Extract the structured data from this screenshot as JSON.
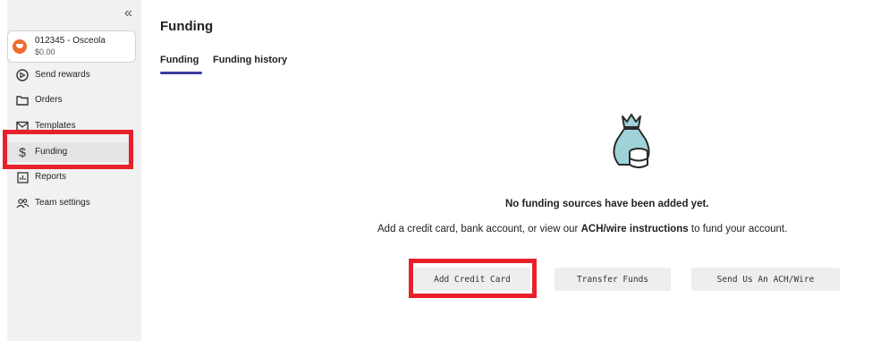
{
  "sidebar": {
    "collapse_glyph": "«",
    "account": {
      "name": "012345 - Osceola",
      "balance": "$0.00",
      "avatar_color": "#ec6b2d"
    },
    "items": [
      {
        "label": "Send rewards",
        "icon": "send-icon"
      },
      {
        "label": "Orders",
        "icon": "folder-icon"
      },
      {
        "label": "Templates",
        "icon": "mail-icon"
      },
      {
        "label": "Funding",
        "icon": "dollar-icon",
        "active": true
      },
      {
        "label": "Reports",
        "icon": "chart-icon"
      },
      {
        "label": "Team settings",
        "icon": "team-icon"
      }
    ]
  },
  "main": {
    "title": "Funding",
    "tabs": [
      {
        "label": "Funding",
        "active": true
      },
      {
        "label": "Funding history"
      }
    ],
    "empty_state": {
      "icon": "money-bag-icon",
      "title": "No funding sources have been added yet.",
      "desc_pre": "Add a credit card, bank account, or view our ",
      "desc_bold": "ACH/wire instructions",
      "desc_post": " to fund your account."
    },
    "buttons": {
      "add_credit_card": "Add Credit Card",
      "transfer_funds": "Transfer Funds",
      "send_ach": "Send Us An ACH/Wire"
    }
  },
  "colors": {
    "highlight": "#e8202a",
    "tab_underline": "#3b3c9e",
    "icon_teal": "#9fd3d8"
  }
}
